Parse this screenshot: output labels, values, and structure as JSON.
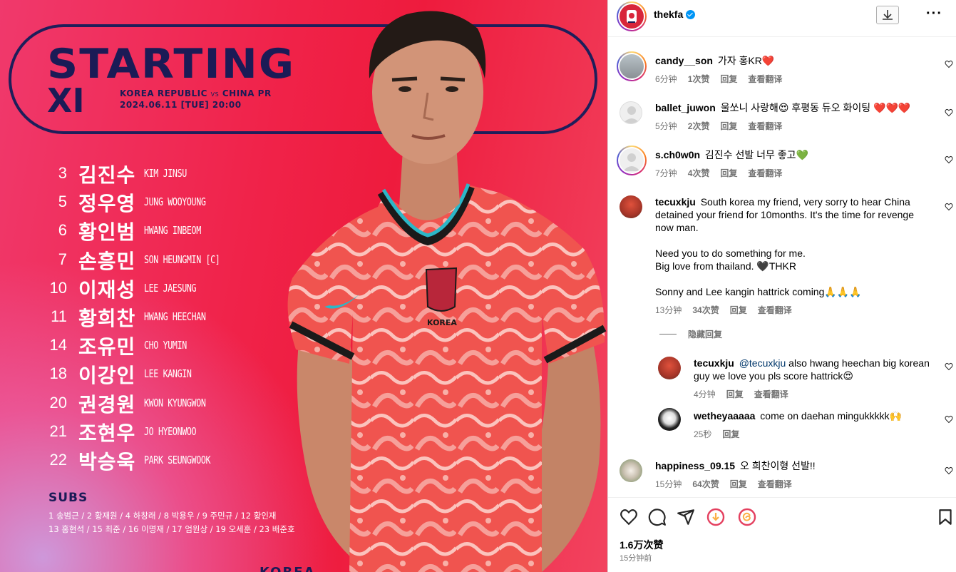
{
  "poster": {
    "title_line1": "STARTING",
    "title_line2": "XI",
    "match_home": "KOREA REPUBLIC",
    "match_vs": "VS",
    "match_away": "CHINA PR",
    "match_date": "2024.06.11 [TUE] 20:00",
    "players": [
      {
        "num": "3",
        "kr": "김진수",
        "en": "KIM JINSU"
      },
      {
        "num": "5",
        "kr": "정우영",
        "en": "JUNG WOOYOUNG"
      },
      {
        "num": "6",
        "kr": "황인범",
        "en": "HWANG INBEOM"
      },
      {
        "num": "7",
        "kr": "손흥민",
        "en": "SON HEUNGMIN [C]"
      },
      {
        "num": "10",
        "kr": "이재성",
        "en": "LEE JAESUNG"
      },
      {
        "num": "11",
        "kr": "황희찬",
        "en": "HWANG HEECHAN"
      },
      {
        "num": "14",
        "kr": "조유민",
        "en": "CHO YUMIN"
      },
      {
        "num": "18",
        "kr": "이강인",
        "en": "LEE KANGIN"
      },
      {
        "num": "20",
        "kr": "권경원",
        "en": "KWON KYUNGWON"
      },
      {
        "num": "21",
        "kr": "조현우",
        "en": "JO HYEONWOO"
      },
      {
        "num": "22",
        "kr": "박승욱",
        "en": "PARK SEUNGWOOK"
      }
    ],
    "subs_title": "SUBS",
    "subs_line1": "1 송범근 / 2 황재원 / 4 하창래 / 8 박용우 / 9 주민규 / 12 황인재",
    "subs_line2": "13 홍현석 / 15 최준 / 16 이명재 / 17 엄원상 / 19 오세훈 / 23 배준호",
    "jersey_text": "KOREA",
    "bottom_text": "KOREA"
  },
  "header": {
    "username": "thekfa",
    "verified_icon": "verified-badge-icon",
    "download_icon": "download-icon",
    "more_label": "···"
  },
  "comments": [
    {
      "user": "candy__son",
      "text": "가자 홍KR❤️",
      "time": "6分钟",
      "likes": "1次赞",
      "reply": "回复",
      "translate": "查看翻译"
    },
    {
      "user": "ballet_juwon",
      "text": "울쏘니 사랑해😍 후평동 듀오 화이팅 ❤️❤️❤️",
      "time": "5分钟",
      "likes": "2次赞",
      "reply": "回复",
      "translate": "查看翻译"
    },
    {
      "user": "s.ch0w0n",
      "text": "김진수 선발 너무 좋고💚",
      "time": "7分钟",
      "likes": "4次赞",
      "reply": "回复",
      "translate": "查看翻译"
    },
    {
      "user": "tecuxkju",
      "text_p1": "South korea my friend, very sorry to hear China detained your friend for 10months. It's the time for revenge now man.",
      "text_p2a": "Need you to do something for me.",
      "text_p2b": "Big love from thailand. 🖤THKR",
      "text_p3": "Sonny and Lee kangin hattrick coming🙏🙏🙏",
      "time": "13分钟",
      "likes": "34次赞",
      "reply": "回复",
      "translate": "查看翻译"
    }
  ],
  "hide_replies": "隐藏回复",
  "replies": [
    {
      "user": "tecuxkju",
      "mention": "@tecuxkju",
      "text": "also hwang heechan big korean guy we love you pls score hattrick😍",
      "time": "4分钟",
      "reply": "回复",
      "translate": "查看翻译"
    },
    {
      "user": "wetheyaaaaa",
      "text": "come on daehan mingukkkkk🙌",
      "time": "25秒",
      "reply": "回复"
    }
  ],
  "last_comment": {
    "user": "happiness_09.15",
    "text": "오 희찬이형 선발!!",
    "time": "15分钟",
    "likes": "64次赞",
    "reply": "回复",
    "translate": "查看翻译"
  },
  "footer": {
    "likes": "1.6万次赞",
    "time_ago": "15分钟前",
    "icons": [
      "heart-icon",
      "comment-icon",
      "share-icon",
      "download-circle-icon",
      "threads-icon",
      "bookmark-icon"
    ]
  },
  "colors": {
    "accent": "#0095f6",
    "poster_red": "#ee1b3d",
    "navy": "#1b1b56",
    "meta_gray": "#737373"
  }
}
